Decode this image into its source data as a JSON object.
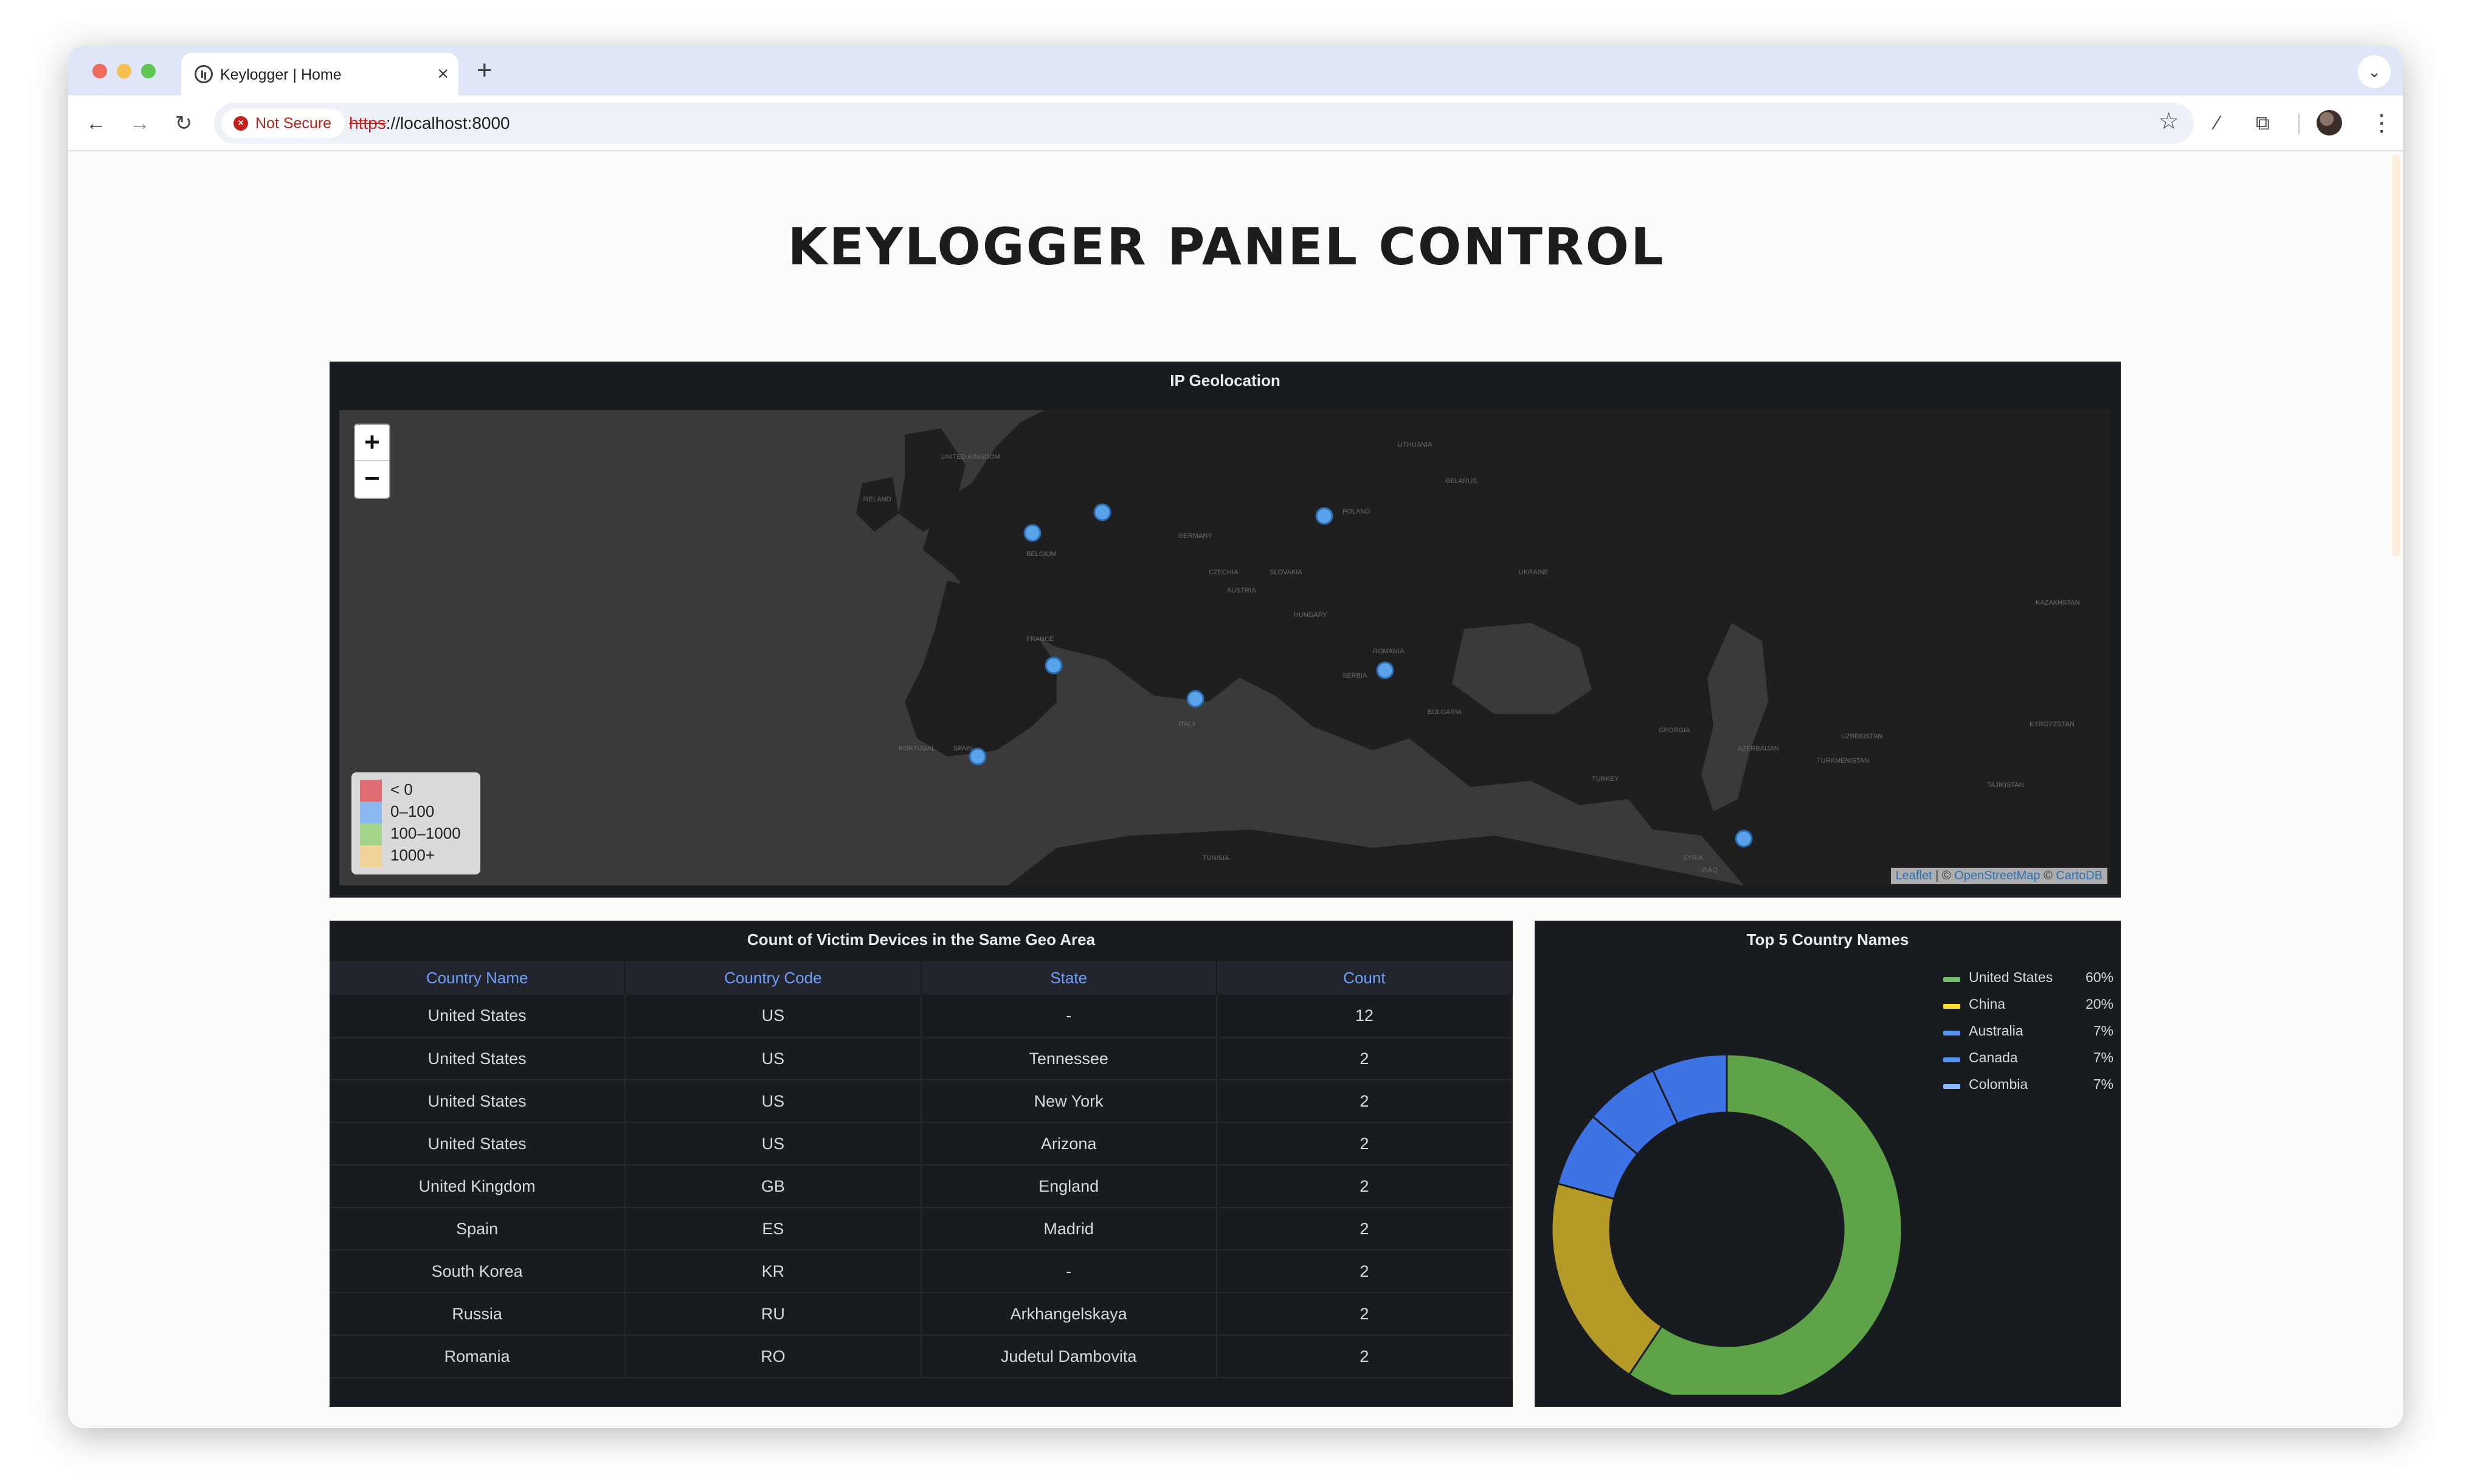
{
  "browser": {
    "tab_title": "Keylogger | Home",
    "tab_close": "×",
    "new_tab": "+",
    "security_label": "Not Secure",
    "url_scheme": "https",
    "url_rest": "://localhost:8000",
    "window_dots": [
      "#ed6a5e",
      "#f5bf4f",
      "#61c554"
    ]
  },
  "page": {
    "title": "KEYLOGGER PANEL CONTROL"
  },
  "map_panel": {
    "title": "IP Geolocation",
    "zoom_in": "+",
    "zoom_out": "−",
    "legend": [
      {
        "label": "< 0",
        "color": "#e06c75"
      },
      {
        "label": "0–100",
        "color": "#8ab8ef"
      },
      {
        "label": "100–1000",
        "color": "#a4d48a"
      },
      {
        "label": "1000+",
        "color": "#f2d49a"
      }
    ],
    "attribution_leaflet": "Leaflet",
    "attribution_osm": "OpenStreetMap",
    "attribution_carto": "CartoDB",
    "marker_color": "#5aa3ea",
    "country_labels": [
      "UNITED KINGDOM",
      "IRELAND",
      "BELGIUM",
      "GERMANY",
      "POLAND",
      "FRANCE",
      "SPAIN",
      "PORTUGAL",
      "ITALY",
      "ROMANIA",
      "UKRAINE",
      "TURKEY",
      "KAZAKHSTAN",
      "BELARUS",
      "LITHUANIA",
      "BULGARIA",
      "GEORGIA",
      "UZBEKISTAN",
      "TURKMENISTAN",
      "SYRIA",
      "IRAQ",
      "TUNISIA",
      "AUSTRIA",
      "HUNGARY",
      "SLOVAKIA",
      "CZECHIA",
      "SERBIA",
      "KYRGYZSTAN",
      "TAJIKISTAN",
      "AZERBAIJAN"
    ]
  },
  "table_panel": {
    "title": "Count of Victim Devices in the Same Geo Area",
    "columns": [
      "Country Name",
      "Country Code",
      "State",
      "Count"
    ],
    "rows": [
      [
        "United States",
        "US",
        "-",
        "12"
      ],
      [
        "United States",
        "US",
        "Tennessee",
        "2"
      ],
      [
        "United States",
        "US",
        "New York",
        "2"
      ],
      [
        "United States",
        "US",
        "Arizona",
        "2"
      ],
      [
        "United Kingdom",
        "GB",
        "England",
        "2"
      ],
      [
        "Spain",
        "ES",
        "Madrid",
        "2"
      ],
      [
        "South Korea",
        "KR",
        "-",
        "2"
      ],
      [
        "Russia",
        "RU",
        "Arkhangelskaya",
        "2"
      ],
      [
        "Romania",
        "RO",
        "Judetul Dambovita",
        "2"
      ]
    ]
  },
  "donut_panel": {
    "title": "Top 5 Country Names",
    "legend": [
      {
        "name": "United States",
        "value": "60%",
        "color": "#73bf69"
      },
      {
        "name": "China",
        "value": "20%",
        "color": "#fade2a"
      },
      {
        "name": "Australia",
        "value": "7%",
        "color": "#5794f2"
      },
      {
        "name": "Canada",
        "value": "7%",
        "color": "#5794f2"
      },
      {
        "name": "Colombia",
        "value": "7%",
        "color": "#8ab8ff"
      }
    ]
  },
  "chart_data": {
    "type": "pie",
    "title": "Top 5 Country Names",
    "categories": [
      "United States",
      "China",
      "Australia",
      "Canada",
      "Colombia"
    ],
    "values": [
      60,
      20,
      7,
      7,
      7
    ],
    "colors": [
      "#5ea347",
      "#b69a27",
      "#3e73e6",
      "#3e73e6",
      "#3e73e6"
    ],
    "donut": true,
    "legend": "right"
  }
}
